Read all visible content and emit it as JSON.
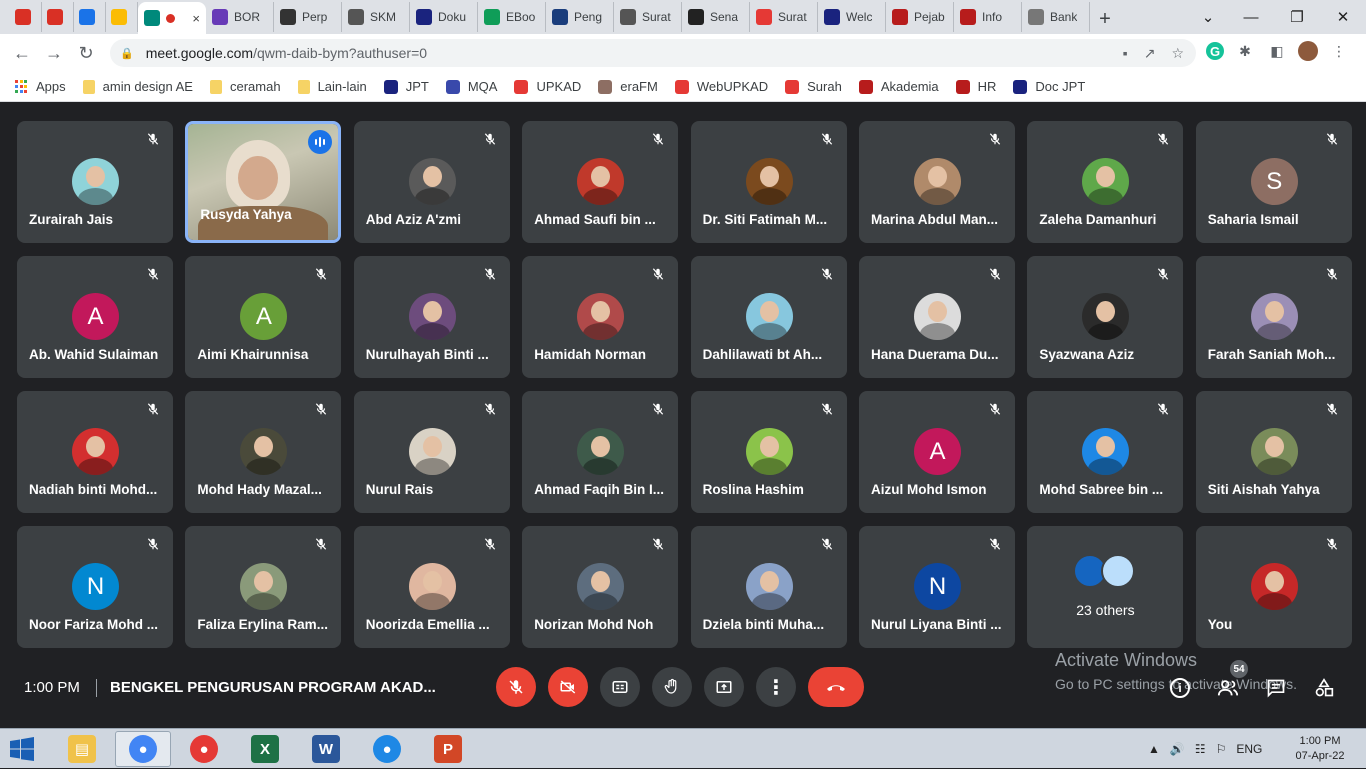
{
  "tabs": [
    {
      "label": "",
      "icon": "gmail-icon",
      "color": "#d93025"
    },
    {
      "label": "",
      "icon": "gmail-icon",
      "color": "#d93025"
    },
    {
      "label": "",
      "icon": "calendar-7-icon",
      "color": "#1a73e8"
    },
    {
      "label": "",
      "icon": "keep-icon",
      "color": "#fbbc04"
    },
    {
      "label": "",
      "icon": "meet-icon",
      "color": "#00897b",
      "active": true
    },
    {
      "label": "BOR",
      "icon": "form-icon",
      "color": "#673ab7"
    },
    {
      "label": "Perp",
      "icon": "site-icon",
      "color": "#333"
    },
    {
      "label": "SKM",
      "icon": "globe-icon",
      "color": "#555"
    },
    {
      "label": "Doku",
      "icon": "jpt-icon",
      "color": "#1a237e"
    },
    {
      "label": "EBoo",
      "icon": "drive-icon",
      "color": "#0f9d58"
    },
    {
      "label": "Peng",
      "icon": "usim-icon",
      "color": "#1a3d7c"
    },
    {
      "label": "Surat",
      "icon": "globe-icon",
      "color": "#555"
    },
    {
      "label": "Sena",
      "icon": "grad-cap-icon",
      "color": "#222"
    },
    {
      "label": "Surat",
      "icon": "upkad-icon",
      "color": "#e53935"
    },
    {
      "label": "Welc",
      "icon": "site-icon",
      "color": "#1a237e"
    },
    {
      "label": "Pejab",
      "icon": "site-icon",
      "color": "#b71c1c"
    },
    {
      "label": "Info",
      "icon": "site-icon",
      "color": "#b71c1c"
    },
    {
      "label": "Bank",
      "icon": "site-icon",
      "color": "#777"
    }
  ],
  "address": {
    "domain": "meet.google.com",
    "path": "/qwm-daib-bym?authuser=0"
  },
  "bookmarks": [
    {
      "label": "Apps",
      "icon": "apps-grid-icon"
    },
    {
      "label": "amin design AE",
      "icon": "folder-icon"
    },
    {
      "label": "ceramah",
      "icon": "folder-icon"
    },
    {
      "label": "Lain-lain",
      "icon": "folder-icon"
    },
    {
      "label": "JPT",
      "icon": "jpt-icon"
    },
    {
      "label": "MQA",
      "icon": "mqa-icon"
    },
    {
      "label": "UPKAD",
      "icon": "upkad-icon"
    },
    {
      "label": "eraFM",
      "icon": "erafm-icon"
    },
    {
      "label": "WebUPKAD",
      "icon": "upkad-icon"
    },
    {
      "label": "Surah",
      "icon": "upkad-icon"
    },
    {
      "label": "Akademia",
      "icon": "shield-icon"
    },
    {
      "label": "HR",
      "icon": "shield-icon"
    },
    {
      "label": "Doc JPT",
      "icon": "jpt-icon"
    }
  ],
  "participants": [
    {
      "name": "Zurairah Jais",
      "color": "#8fd3d9",
      "muted": true
    },
    {
      "name": "Rusyda Yahya",
      "video": true,
      "speaking": true
    },
    {
      "name": "Abd Aziz A'zmi",
      "color": "#5a5a5a",
      "muted": true
    },
    {
      "name": "Ahmad Saufi bin ...",
      "color": "#c0392b",
      "muted": true
    },
    {
      "name": "Dr. Siti Fatimah M...",
      "color": "#7b4a1e",
      "muted": true
    },
    {
      "name": "Marina Abdul Man...",
      "color": "#b08a6a",
      "muted": true
    },
    {
      "name": "Zaleha Damanhuri",
      "color": "#5fa84a",
      "muted": true
    },
    {
      "name": "Saharia Ismail",
      "initial": "S",
      "color": "#8d6e63",
      "muted": true
    },
    {
      "name": "Ab. Wahid Sulaiman",
      "initial": "A",
      "color": "#c2185b",
      "muted": true
    },
    {
      "name": "Aimi Khairunnisa",
      "initial": "A",
      "color": "#689f38",
      "muted": true
    },
    {
      "name": "Nurulhayah Binti ...",
      "color": "#6d4c7d",
      "muted": true
    },
    {
      "name": "Hamidah Norman",
      "color": "#b04a4a",
      "muted": true
    },
    {
      "name": "Dahlilawati bt Ah...",
      "color": "#87c7de",
      "muted": true
    },
    {
      "name": "Hana Duerama Du...",
      "color": "#dcdcdc",
      "muted": true
    },
    {
      "name": "Syazwana Aziz",
      "color": "#2b2b2b",
      "muted": true
    },
    {
      "name": "Farah Saniah Moh...",
      "color": "#9b8fb6",
      "muted": true
    },
    {
      "name": "Nadiah binti Mohd...",
      "color": "#d32f2f",
      "muted": true
    },
    {
      "name": "Mohd Hady Mazal...",
      "color": "#4a4a3a",
      "muted": true
    },
    {
      "name": "Nurul Rais",
      "color": "#d9d2c5",
      "muted": true
    },
    {
      "name": "Ahmad Faqih Bin I...",
      "color": "#3e5a4a",
      "muted": true
    },
    {
      "name": "Roslina Hashim",
      "color": "#8bc34a",
      "muted": true
    },
    {
      "name": "Aizul Mohd Ismon",
      "initial": "A",
      "color": "#c2185b",
      "muted": true
    },
    {
      "name": "Mohd Sabree bin ...",
      "color": "#1e88e5",
      "muted": true
    },
    {
      "name": "Siti Aishah Yahya",
      "color": "#7a8c5a",
      "muted": true
    },
    {
      "name": "Noor Fariza Mohd ...",
      "initial": "N",
      "color": "#0288d1",
      "muted": true
    },
    {
      "name": "Faliza Erylina Ram...",
      "color": "#8a9a7a",
      "muted": true
    },
    {
      "name": "Noorizda Emellia ...",
      "color": "#e0b7a0",
      "muted": true
    },
    {
      "name": "Norizan Mohd Noh",
      "color": "#5d6d7e",
      "muted": true
    },
    {
      "name": "Dziela binti Muha...",
      "color": "#8aa2c8",
      "muted": true
    },
    {
      "name": "Nurul Liyana Binti ...",
      "initial": "N",
      "color": "#0d47a1",
      "muted": true
    },
    {
      "name": "",
      "others": "23 others"
    },
    {
      "name": "You",
      "color": "#c62828",
      "muted": true
    }
  ],
  "meeting": {
    "time": "1:00 PM",
    "title": "BENGKEL PENGURUSAN PROGRAM AKAD...",
    "participant_count": "54"
  },
  "watermark": {
    "line1": "Activate Windows",
    "line2": "Go to PC settings to activate Windows."
  },
  "tray": {
    "lang": "ENG",
    "time": "1:00 PM",
    "date": "07-Apr-22"
  },
  "taskbar_apps": [
    {
      "icon": "file-explorer-icon",
      "color": "#f0c24a"
    },
    {
      "icon": "chrome-icon",
      "color": "#4285f4",
      "active": true
    },
    {
      "icon": "pdf-reader-icon",
      "color": "#e53935"
    },
    {
      "icon": "excel-icon",
      "color": "#1e7145"
    },
    {
      "icon": "word-icon",
      "color": "#2b579a"
    },
    {
      "icon": "browser-icon",
      "color": "#1e88e5"
    },
    {
      "icon": "powerpoint-icon",
      "color": "#d24726"
    }
  ]
}
